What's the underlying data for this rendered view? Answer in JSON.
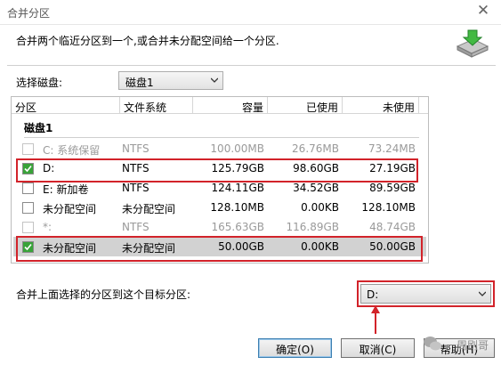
{
  "window": {
    "title": "合并分区",
    "close_glyph": "✕"
  },
  "description": "合并两个临近分区到一个,或合并未分配空间给一个分区.",
  "header_icon": "disk-merge-icon",
  "disk_select": {
    "label": "选择磁盘:",
    "value": "磁盘1"
  },
  "table": {
    "columns": [
      "分区",
      "文件系统",
      "容量",
      "已使用",
      "未使用"
    ],
    "group": "磁盘1",
    "rows": [
      {
        "name": "C:  系统保留",
        "fs": "NTFS",
        "capacity": "100.00MB",
        "used": "26.76MB",
        "free": "73.24MB",
        "checked": false,
        "disabled": true,
        "selected": false
      },
      {
        "name": "D:",
        "fs": "NTFS",
        "capacity": "125.79GB",
        "used": "98.60GB",
        "free": "27.19GB",
        "checked": true,
        "disabled": false,
        "selected": false
      },
      {
        "name": "E:  新加卷",
        "fs": "NTFS",
        "capacity": "124.11GB",
        "used": "34.52GB",
        "free": "89.59GB",
        "checked": false,
        "disabled": false,
        "selected": false
      },
      {
        "name": "未分配空间",
        "fs": "未分配空间",
        "capacity": "128.10MB",
        "used": "0.00KB",
        "free": "128.10MB",
        "checked": false,
        "disabled": false,
        "selected": false
      },
      {
        "name": "*:",
        "fs": "NTFS",
        "capacity": "165.63GB",
        "used": "116.89GB",
        "free": "48.74GB",
        "checked": false,
        "disabled": true,
        "selected": false
      },
      {
        "name": "未分配空间",
        "fs": "未分配空间",
        "capacity": "50.00GB",
        "used": "0.00KB",
        "free": "50.00GB",
        "checked": true,
        "disabled": false,
        "selected": true
      }
    ]
  },
  "merge": {
    "label": "合并上面选择的分区到这个目标分区:",
    "target_value": "D:"
  },
  "buttons": {
    "ok": "确定(O)",
    "cancel": "取消(C)",
    "help": "帮助(H)"
  },
  "watermark": "一周刷哥",
  "colors": {
    "highlight": "#d2232a",
    "check": "#39a339",
    "selected_row": "#d2d2d2"
  }
}
